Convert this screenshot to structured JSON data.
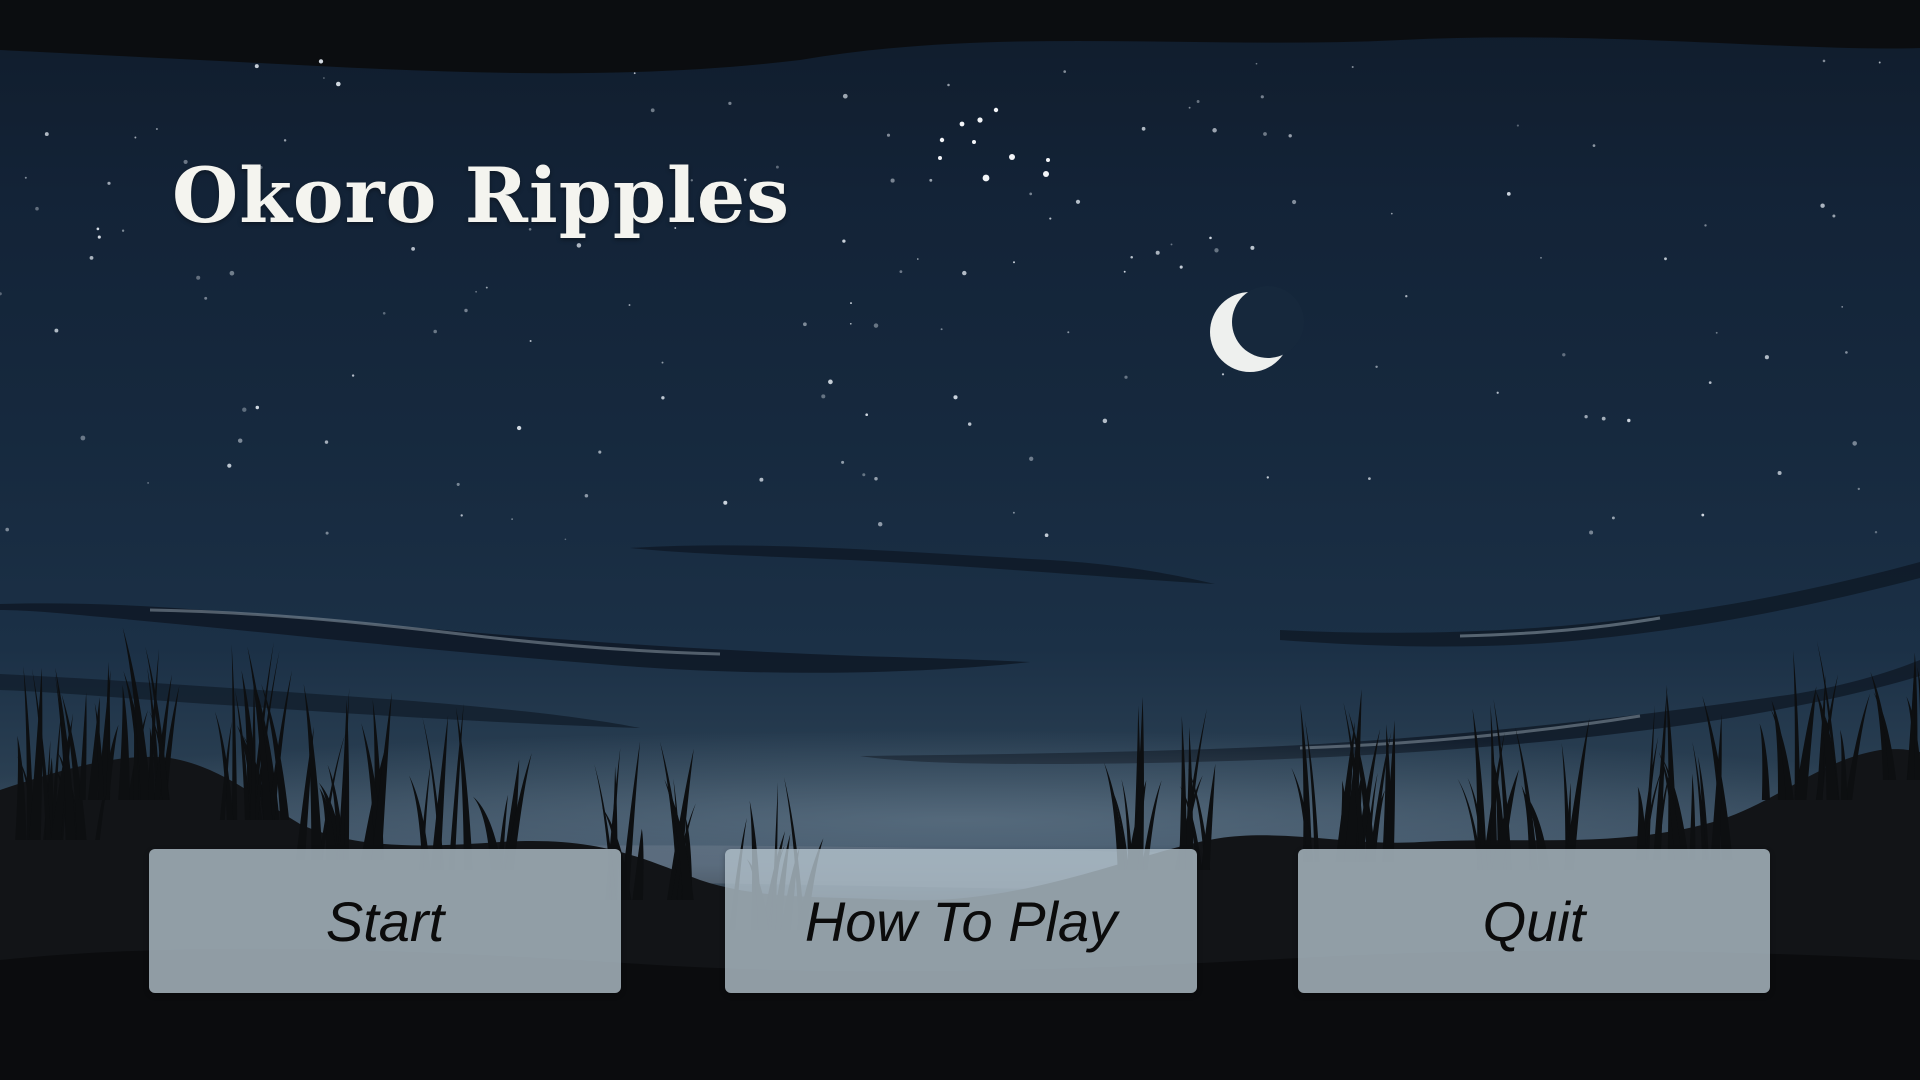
{
  "game": {
    "title": "Okoro Ripples"
  },
  "menu": {
    "start_label": "Start",
    "how_to_play_label": "How To Play",
    "quit_label": "Quit"
  },
  "colors": {
    "sky_top": "#101c2b",
    "sky_mid": "#16293e",
    "horizon_glow": "#3e5266",
    "ground": "#0e1013",
    "button_fill": "#b2c0cb",
    "title_text": "#f4f4ef"
  },
  "icons": {
    "moon": "crescent-moon-icon"
  }
}
